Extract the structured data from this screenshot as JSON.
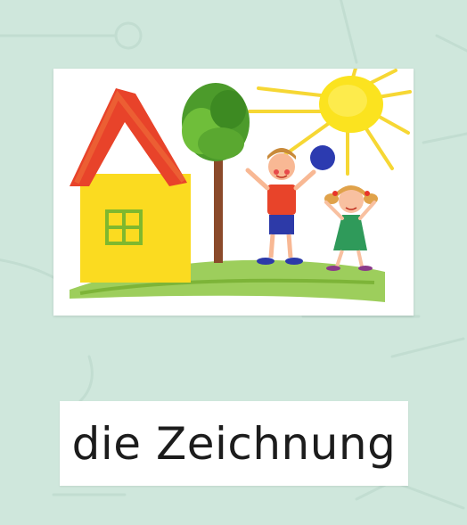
{
  "flashcard": {
    "image_subject": "children-drawing",
    "word": "die Zeichnung"
  },
  "colors": {
    "background": "#cfe7dc",
    "card": "#ffffff",
    "text": "#1c1c1c"
  }
}
